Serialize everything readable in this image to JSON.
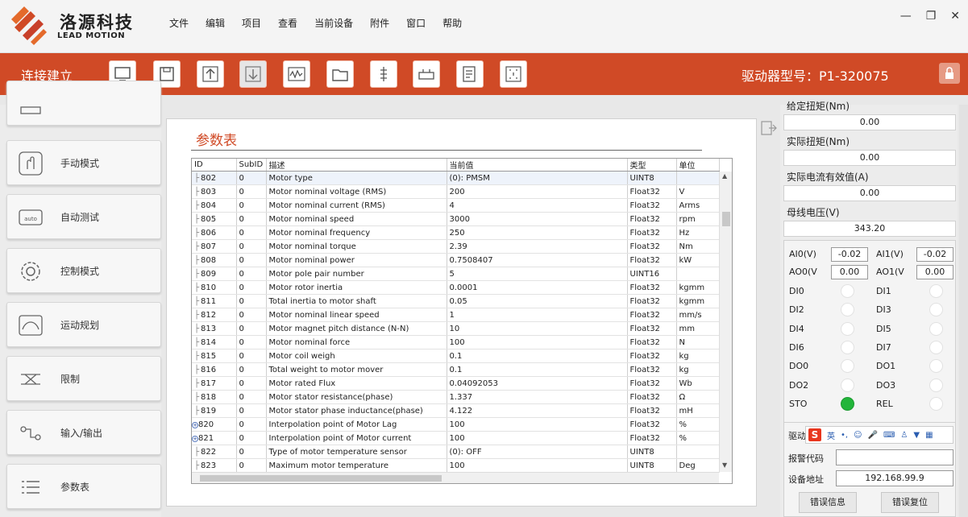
{
  "app": {
    "logo_cn": "洛源科技",
    "logo_en": "LEAD MOTION",
    "menu": [
      "文件",
      "编辑",
      "项目",
      "查看",
      "当前设备",
      "附件",
      "窗口",
      "帮助"
    ]
  },
  "toolbar": {
    "status": "连接建立",
    "drive_model": "驱动器型号：P1-320075",
    "icons": [
      "monitor-icon",
      "save-icon",
      "upload-icon",
      "download-icon",
      "oscilloscope-icon",
      "folder-icon",
      "tuning-icon",
      "drive-icon",
      "report-icon",
      "grid-icon"
    ]
  },
  "sidebar": {
    "items": [
      {
        "label": "手动模式",
        "icon": "hand-icon"
      },
      {
        "label": "自动测试",
        "icon": "auto-icon"
      },
      {
        "label": "控制模式",
        "icon": "gear-icon"
      },
      {
        "label": "运动规划",
        "icon": "curve-icon"
      },
      {
        "label": "限制",
        "icon": "limit-icon"
      },
      {
        "label": "输入/输出",
        "icon": "io-icon"
      },
      {
        "label": "参数表",
        "icon": "list-icon"
      }
    ]
  },
  "params": {
    "title": "参数表",
    "columns": [
      "ID",
      "SubID",
      "描述",
      "当前值",
      "类型",
      "单位"
    ],
    "rows": [
      [
        "802",
        "0",
        "Motor type",
        "(0): PMSM",
        "UINT8",
        ""
      ],
      [
        "803",
        "0",
        "Motor nominal voltage (RMS)",
        "200",
        "Float32",
        "V"
      ],
      [
        "804",
        "0",
        "Motor nominal current (RMS)",
        "4",
        "Float32",
        "Arms"
      ],
      [
        "805",
        "0",
        "Motor nominal speed",
        "3000",
        "Float32",
        "rpm"
      ],
      [
        "806",
        "0",
        "Motor nominal frequency",
        "250",
        "Float32",
        "Hz"
      ],
      [
        "807",
        "0",
        "Motor nominal torque",
        "2.39",
        "Float32",
        "Nm"
      ],
      [
        "808",
        "0",
        "Motor nominal power",
        "0.7508407",
        "Float32",
        "kW"
      ],
      [
        "809",
        "0",
        "Motor pole pair number",
        "5",
        "UINT16",
        ""
      ],
      [
        "810",
        "0",
        "Motor rotor inertia",
        "0.0001",
        "Float32",
        "kgmm"
      ],
      [
        "811",
        "0",
        "Total inertia to motor shaft",
        "0.05",
        "Float32",
        "kgmm"
      ],
      [
        "812",
        "0",
        "Motor nominal linear speed",
        "1",
        "Float32",
        "mm/s"
      ],
      [
        "813",
        "0",
        "Motor magnet pitch distance (N-N)",
        "10",
        "Float32",
        "mm"
      ],
      [
        "814",
        "0",
        "Motor nominal force",
        "100",
        "Float32",
        "N"
      ],
      [
        "815",
        "0",
        "Motor coil weigh",
        "0.1",
        "Float32",
        "kg"
      ],
      [
        "816",
        "0",
        "Total weight to motor mover",
        "0.1",
        "Float32",
        "kg"
      ],
      [
        "817",
        "0",
        "Motor rated Flux",
        "0.04092053",
        "Float32",
        "Wb"
      ],
      [
        "818",
        "0",
        "Motor stator resistance(phase)",
        "1.337",
        "Float32",
        "Ω"
      ],
      [
        "819",
        "0",
        "Motor stator phase inductance(phase)",
        "4.122",
        "Float32",
        "mH"
      ],
      [
        "820",
        "0",
        "Interpolation point of Motor Lag",
        "100",
        "Float32",
        "%"
      ],
      [
        "821",
        "0",
        "Interpolation point of Motor current",
        "100",
        "Float32",
        "%"
      ],
      [
        "822",
        "0",
        "Type of motor temperature sensor",
        "(0): OFF",
        "UINT8",
        ""
      ],
      [
        "823",
        "0",
        "Maximum motor temperature",
        "100",
        "UINT8",
        "Deg"
      ]
    ]
  },
  "right": {
    "partial_label": "给定扭矩(Nm)",
    "rated_torque_value": "0.00",
    "actual_torque_label": "实际扭矩(Nm)",
    "actual_torque_value": "0.00",
    "actual_current_label": "实际电流有效值(A)",
    "actual_current_value": "0.00",
    "bus_voltage_label": "母线电压(V)",
    "bus_voltage_value": "343.20",
    "ai0_label": "AI0(V)",
    "ai0_value": "-0.02",
    "ai1_label": "AI1(V)",
    "ai1_value": "-0.02",
    "ao0_label": "AO0(V",
    "ao0_value": "0.00",
    "ao1_label": "AO1(V",
    "ao1_value": "0.00",
    "digital": [
      {
        "left": "DI0",
        "right": "DI1"
      },
      {
        "left": "DI2",
        "right": "DI3"
      },
      {
        "left": "DI4",
        "right": "DI5"
      },
      {
        "left": "DI6",
        "right": "DI7"
      },
      {
        "left": "DO0",
        "right": "DO1"
      },
      {
        "left": "DO2",
        "right": "DO3"
      },
      {
        "left": "STO",
        "right": "REL"
      }
    ],
    "sto_on": true,
    "drive_label": "驱动",
    "ime_lang": "英",
    "error_code_label": "报警代码",
    "device_addr_label": "设备地址",
    "device_addr_value": "192.168.99.9",
    "error_info_btn": "错误信息",
    "error_reset_btn": "错误复位",
    "accent": "#d04a26"
  }
}
